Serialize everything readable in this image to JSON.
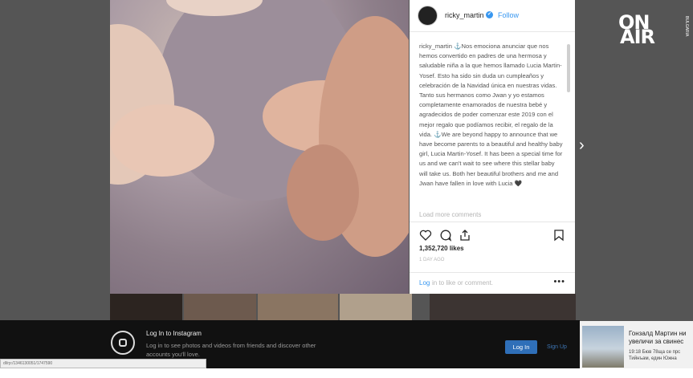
{
  "post": {
    "username": "ricky_martin",
    "verified_mark": "✔",
    "follow_label": "Follow",
    "caption": "ricky_martin ⚓Nos emociona anunciar que nos hemos convertido en padres de una hermosa y saludable niña a la que hemos llamado Lucia Martin-Yosef. Esto ha sido sin duda un cumpleaños y celebración de la Navidad única en nuestras vidas. Tanto sus hermanos como Jwan y yo estamos completamente enamorados de nuestra bebé y agradecidos de poder comenzar este 2019 con el mejor regalo que podíamos recibir, el regalo de la vida. ⚓We are beyond happy to announce that we have become parents to a beautiful and healthy baby girl, Lucia Martin-Yosef. It has been a special time for us and we can't wait to see where this stellar baby will take us. Both her beautiful brothers and me and Jwan have fallen in love with Lucia 🖤",
    "load_more": "Load more comments",
    "likes": "1,352,720 likes",
    "date": "1 DAY AGO",
    "comment_login_link": "Log",
    "comment_placeholder": "in to like or comment.",
    "more_dots": "•••",
    "icons": [
      "heart-icon",
      "comment-icon",
      "share-icon",
      "bookmark-icon"
    ]
  },
  "nav": {
    "next_arrow": "›"
  },
  "logo": {
    "line1": "ON",
    "line2": "AIR",
    "sub": "BULGARIA"
  },
  "login_bar": {
    "title": "Log In to Instagram",
    "desc": "Log in to see photos and videos from friends and discover other accounts you'll love.",
    "login_button": "Log In",
    "signup": "Sign Up"
  },
  "url_status": "dl/rp:/1346130051/1747590",
  "news": {
    "title_line1": "Гонзалд Мартин ни",
    "title_line2": "увеличи за свинес",
    "sub_line1": "19:18 Бюв 78ща се прс",
    "sub_line2": "Тийнъам, един Южна"
  },
  "colors": {
    "accent": "#3897f0",
    "login_button": "#2f6fb8",
    "bar": "#111111"
  }
}
